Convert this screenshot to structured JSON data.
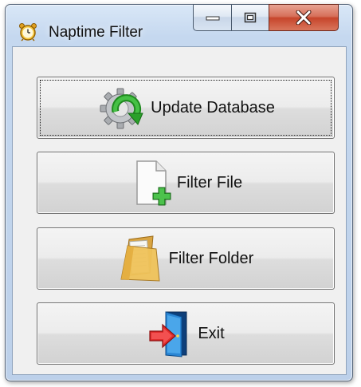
{
  "window": {
    "title": "Naptime Filter",
    "icon": "alarm-clock-icon"
  },
  "caption_buttons": {
    "minimize_icon": "minimize-icon",
    "maximize_icon": "maximize-icon",
    "close_icon": "close-icon"
  },
  "buttons": [
    {
      "label": "Update Database",
      "icon": "gear-refresh-icon"
    },
    {
      "label": "Filter File",
      "icon": "file-add-icon"
    },
    {
      "label": "Filter Folder",
      "icon": "folder-icon"
    },
    {
      "label": "Exit",
      "icon": "exit-door-icon"
    }
  ],
  "colors": {
    "close_red": "#c7452b",
    "green": "#2e9b2e",
    "exit_arrow": "#d42a2a",
    "door_blue": "#1f6fb7"
  }
}
